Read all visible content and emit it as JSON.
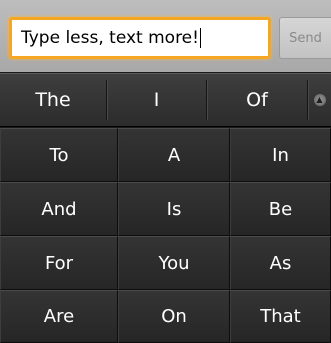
{
  "composer": {
    "input_value": "Type less, text more!",
    "send_label": "Send"
  },
  "suggestions": {
    "words": [
      "The",
      "I",
      "Of"
    ],
    "expand_icon": "chevron-up-icon"
  },
  "keypad": {
    "rows": [
      [
        "To",
        "A",
        "In"
      ],
      [
        "And",
        "Is",
        "Be"
      ],
      [
        "For",
        "You",
        "As"
      ],
      [
        "Are",
        "On",
        "That"
      ]
    ]
  },
  "colors": {
    "input_focus_border": "#f5a623",
    "key_background": "#2d2d2d",
    "key_text": "#ffffff",
    "top_bar": "#b0b0b0"
  }
}
